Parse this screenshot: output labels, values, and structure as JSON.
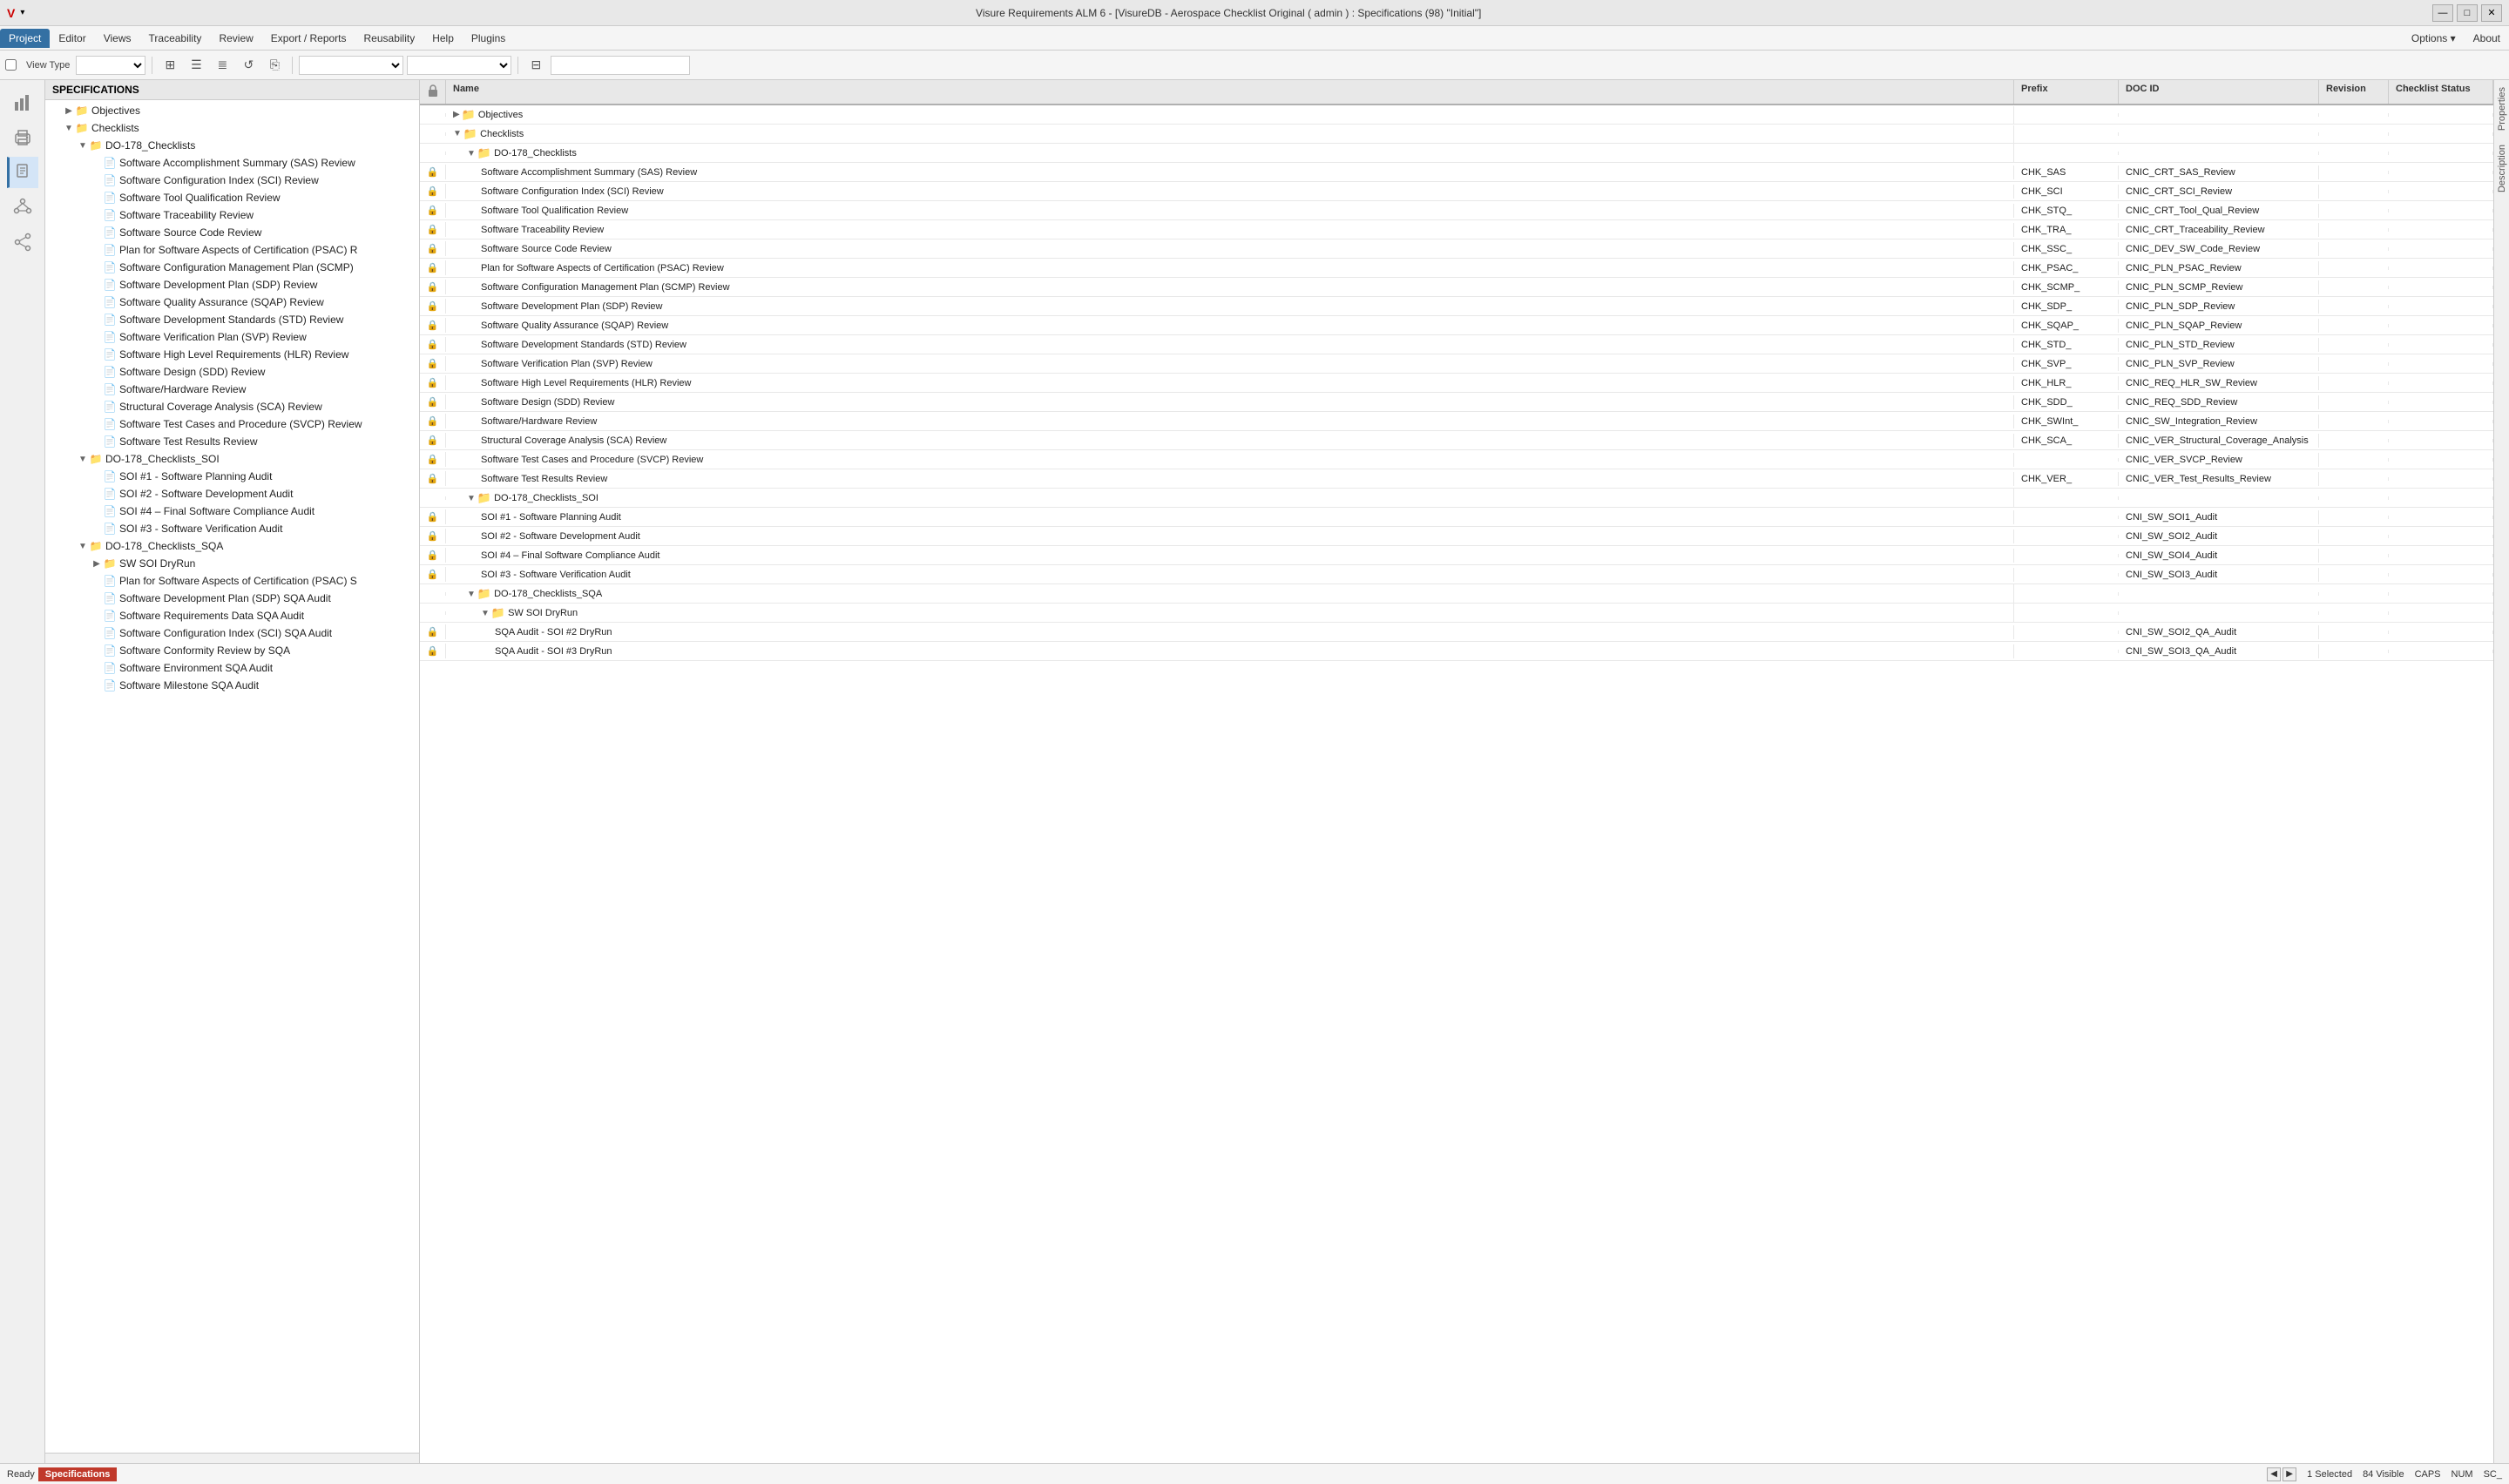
{
  "titlebar": {
    "title": "Visure Requirements ALM 6 - [VisureDB - Aerospace Checklist Original ( admin ) : Specifications (98) \"Initial\"]",
    "minimize": "—",
    "maximize": "□",
    "close": "✕",
    "logo": "V"
  },
  "menubar": {
    "items": [
      {
        "label": "Project",
        "active": true
      },
      {
        "label": "Editor"
      },
      {
        "label": "Views"
      },
      {
        "label": "Traceability"
      },
      {
        "label": "Review"
      },
      {
        "label": "Export / Reports"
      },
      {
        "label": "Reusability"
      },
      {
        "label": "Help"
      },
      {
        "label": "Plugins"
      },
      {
        "label": "Options ▾",
        "right": true
      },
      {
        "label": "About",
        "right": true
      }
    ]
  },
  "toolbar": {
    "view_type_label": "View Type",
    "filter_icon": "⊞",
    "icons": [
      "⊞",
      "☰",
      "≣",
      "↺",
      "⎘"
    ],
    "search_placeholder": ""
  },
  "iconbar": {
    "icons": [
      {
        "name": "chart",
        "symbol": "📊"
      },
      {
        "name": "print",
        "symbol": "🖨"
      },
      {
        "name": "doc",
        "symbol": "📄"
      },
      {
        "name": "network",
        "symbol": "⬡"
      },
      {
        "name": "share",
        "symbol": "⬡"
      }
    ]
  },
  "tree": {
    "header": "SPECIFICATIONS",
    "nodes": [
      {
        "id": "objectives",
        "label": "Objectives",
        "level": 0,
        "type": "folder",
        "expandable": true,
        "expanded": false
      },
      {
        "id": "checklists",
        "label": "Checklists",
        "level": 0,
        "type": "folder",
        "expandable": true,
        "expanded": true
      },
      {
        "id": "do178-checklists",
        "label": "DO-178_Checklists",
        "level": 1,
        "type": "folder",
        "expandable": true,
        "expanded": true
      },
      {
        "id": "item1",
        "label": "Software Accomplishment Summary (SAS) Review",
        "level": 2,
        "type": "doc"
      },
      {
        "id": "item2",
        "label": "Software Configuration Index (SCI) Review",
        "level": 2,
        "type": "doc"
      },
      {
        "id": "item3",
        "label": "Software Tool Qualification Review",
        "level": 2,
        "type": "doc"
      },
      {
        "id": "item4",
        "label": "Software Traceability Review",
        "level": 2,
        "type": "doc"
      },
      {
        "id": "item5",
        "label": "Software Source Code Review",
        "level": 2,
        "type": "doc"
      },
      {
        "id": "item6",
        "label": "Plan for Software Aspects of Certification (PSAC) R",
        "level": 2,
        "type": "doc"
      },
      {
        "id": "item7",
        "label": "Software Configuration Management Plan (SCMP)",
        "level": 2,
        "type": "doc"
      },
      {
        "id": "item8",
        "label": "Software Development Plan (SDP) Review",
        "level": 2,
        "type": "doc"
      },
      {
        "id": "item9",
        "label": "Software Quality Assurance (SQAP) Review",
        "level": 2,
        "type": "doc"
      },
      {
        "id": "item10",
        "label": "Software Development Standards (STD) Review",
        "level": 2,
        "type": "doc"
      },
      {
        "id": "item11",
        "label": "Software Verification Plan (SVP) Review",
        "level": 2,
        "type": "doc"
      },
      {
        "id": "item12",
        "label": "Software High Level Requirements (HLR) Review",
        "level": 2,
        "type": "doc"
      },
      {
        "id": "item13",
        "label": "Software Design (SDD) Review",
        "level": 2,
        "type": "doc"
      },
      {
        "id": "item14",
        "label": "Software/Hardware Review",
        "level": 2,
        "type": "doc"
      },
      {
        "id": "item15",
        "label": "Structural Coverage Analysis (SCA) Review",
        "level": 2,
        "type": "doc"
      },
      {
        "id": "item16",
        "label": "Software Test Cases and Procedure (SVCP) Review",
        "level": 2,
        "type": "doc"
      },
      {
        "id": "item17",
        "label": "Software Test Results Review",
        "level": 2,
        "type": "doc"
      },
      {
        "id": "do178-checklists-soi",
        "label": "DO-178_Checklists_SOI",
        "level": 1,
        "type": "folder",
        "expandable": true,
        "expanded": true
      },
      {
        "id": "soi1",
        "label": "SOI #1 - Software Planning Audit",
        "level": 2,
        "type": "doc"
      },
      {
        "id": "soi2",
        "label": "SOI #2 - Software Development Audit",
        "level": 2,
        "type": "doc"
      },
      {
        "id": "soi4",
        "label": "SOI #4 – Final Software Compliance Audit",
        "level": 2,
        "type": "doc"
      },
      {
        "id": "soi3",
        "label": "SOI #3 - Software Verification Audit",
        "level": 2,
        "type": "doc"
      },
      {
        "id": "do178-checklists-sqa",
        "label": "DO-178_Checklists_SQA",
        "level": 1,
        "type": "folder",
        "expandable": true,
        "expanded": true
      },
      {
        "id": "sw-soi-dryrun",
        "label": "SW SOI DryRun",
        "level": 2,
        "type": "folder",
        "expandable": true,
        "expanded": false
      },
      {
        "id": "psac-s",
        "label": "Plan for Software Aspects of Certification (PSAC) S",
        "level": 2,
        "type": "doc"
      },
      {
        "id": "sdp-sqa",
        "label": "Software Development Plan (SDP) SQA Audit",
        "level": 2,
        "type": "doc"
      },
      {
        "id": "srd-sqa",
        "label": "Software Requirements Data SQA Audit",
        "level": 2,
        "type": "doc"
      },
      {
        "id": "sci-sqa",
        "label": "Software Configuration Index (SCI) SQA Audit",
        "level": 2,
        "type": "doc"
      },
      {
        "id": "scr-sqa",
        "label": "Software Conformity Review by SQA",
        "level": 2,
        "type": "doc"
      },
      {
        "id": "sea-sqa",
        "label": "Software Environment SQA Audit",
        "level": 2,
        "type": "doc"
      },
      {
        "id": "sm-sqa",
        "label": "Software Milestone SQA Audit",
        "level": 2,
        "type": "doc"
      }
    ]
  },
  "grid": {
    "columns": [
      {
        "key": "lock",
        "label": "🔒"
      },
      {
        "key": "name",
        "label": "Name"
      },
      {
        "key": "prefix",
        "label": "Prefix"
      },
      {
        "key": "docid",
        "label": "DOC ID"
      },
      {
        "key": "revision",
        "label": "Revision"
      },
      {
        "key": "status",
        "label": "Checklist Status"
      }
    ],
    "rows": [
      {
        "indent": 0,
        "type": "folder",
        "expand": "▶",
        "name": "Objectives",
        "prefix": "",
        "docid": "",
        "revision": "",
        "status": "",
        "locked": true
      },
      {
        "indent": 0,
        "type": "folder",
        "expand": "▼",
        "name": "Checklists",
        "prefix": "",
        "docid": "",
        "revision": "",
        "status": "",
        "locked": false
      },
      {
        "indent": 1,
        "type": "folder",
        "expand": "▼",
        "name": "DO-178_Checklists",
        "prefix": "",
        "docid": "",
        "revision": "",
        "status": "",
        "locked": false
      },
      {
        "indent": 2,
        "type": "doc",
        "expand": "",
        "name": "Software Accomplishment Summary (SAS) Review",
        "prefix": "CHK_SAS",
        "docid": "CNIC_CRT_SAS_Review",
        "revision": "",
        "status": "",
        "locked": true
      },
      {
        "indent": 2,
        "type": "doc",
        "expand": "",
        "name": "Software Configuration Index (SCI) Review",
        "prefix": "CHK_SCI",
        "docid": "CNIC_CRT_SCI_Review",
        "revision": "",
        "status": "",
        "locked": true
      },
      {
        "indent": 2,
        "type": "doc",
        "expand": "",
        "name": "Software Tool Qualification Review",
        "prefix": "CHK_STQ_",
        "docid": "CNIC_CRT_Tool_Qual_Review",
        "revision": "",
        "status": "",
        "locked": true
      },
      {
        "indent": 2,
        "type": "doc",
        "expand": "",
        "name": "Software Traceability Review",
        "prefix": "CHK_TRA_",
        "docid": "CNIC_CRT_Traceability_Review",
        "revision": "",
        "status": "",
        "locked": true
      },
      {
        "indent": 2,
        "type": "doc",
        "expand": "",
        "name": "Software Source Code Review",
        "prefix": "CHK_SSC_",
        "docid": "CNIC_DEV_SW_Code_Review",
        "revision": "",
        "status": "",
        "locked": true
      },
      {
        "indent": 2,
        "type": "doc",
        "expand": "",
        "name": "Plan for Software Aspects of Certification (PSAC) Review",
        "prefix": "CHK_PSAC_",
        "docid": "CNIC_PLN_PSAC_Review",
        "revision": "",
        "status": "",
        "locked": true
      },
      {
        "indent": 2,
        "type": "doc",
        "expand": "",
        "name": "Software Configuration Management Plan (SCMP) Review",
        "prefix": "CHK_SCMP_",
        "docid": "CNIC_PLN_SCMP_Review",
        "revision": "",
        "status": "",
        "locked": true
      },
      {
        "indent": 2,
        "type": "doc",
        "expand": "",
        "name": "Software Development Plan (SDP) Review",
        "prefix": "CHK_SDP_",
        "docid": "CNIC_PLN_SDP_Review",
        "revision": "",
        "status": "",
        "locked": true
      },
      {
        "indent": 2,
        "type": "doc",
        "expand": "",
        "name": "Software Quality Assurance (SQAP) Review",
        "prefix": "CHK_SQAP_",
        "docid": "CNIC_PLN_SQAP_Review",
        "revision": "",
        "status": "",
        "locked": true
      },
      {
        "indent": 2,
        "type": "doc",
        "expand": "",
        "name": "Software Development Standards (STD) Review",
        "prefix": "CHK_STD_",
        "docid": "CNIC_PLN_STD_Review",
        "revision": "",
        "status": "",
        "locked": true
      },
      {
        "indent": 2,
        "type": "doc",
        "expand": "",
        "name": "Software Verification Plan (SVP) Review",
        "prefix": "CHK_SVP_",
        "docid": "CNIC_PLN_SVP_Review",
        "revision": "",
        "status": "",
        "locked": true
      },
      {
        "indent": 2,
        "type": "doc",
        "expand": "",
        "name": "Software High Level Requirements (HLR) Review",
        "prefix": "CHK_HLR_",
        "docid": "CNIC_REQ_HLR_SW_Review",
        "revision": "",
        "status": "",
        "locked": true
      },
      {
        "indent": 2,
        "type": "doc",
        "expand": "",
        "name": "Software Design (SDD) Review",
        "prefix": "CHK_SDD_",
        "docid": "CNIC_REQ_SDD_Review",
        "revision": "",
        "status": "",
        "locked": true
      },
      {
        "indent": 2,
        "type": "doc",
        "expand": "",
        "name": "Software/Hardware Review",
        "prefix": "CHK_SWInt_",
        "docid": "CNIC_SW_Integration_Review",
        "revision": "",
        "status": "",
        "locked": true
      },
      {
        "indent": 2,
        "type": "doc",
        "expand": "",
        "name": "Structural Coverage Analysis (SCA) Review",
        "prefix": "CHK_SCA_",
        "docid": "CNIC_VER_Structural_Coverage_Analysis",
        "revision": "",
        "status": "",
        "locked": true
      },
      {
        "indent": 2,
        "type": "doc",
        "expand": "",
        "name": "Software Test Cases and Procedure (SVCP) Review",
        "prefix": "",
        "docid": "CNIC_VER_SVCP_Review",
        "revision": "",
        "status": "",
        "locked": true
      },
      {
        "indent": 2,
        "type": "doc",
        "expand": "",
        "name": "Software Test Results Review",
        "prefix": "CHK_VER_",
        "docid": "CNIC_VER_Test_Results_Review",
        "revision": "",
        "status": "",
        "locked": true
      },
      {
        "indent": 1,
        "type": "folder",
        "expand": "▼",
        "name": "DO-178_Checklists_SOI",
        "prefix": "",
        "docid": "",
        "revision": "",
        "status": "",
        "locked": false
      },
      {
        "indent": 2,
        "type": "doc",
        "expand": "",
        "name": "SOI #1 - Software Planning Audit",
        "prefix": "",
        "docid": "CNI_SW_SOI1_Audit",
        "revision": "",
        "status": "",
        "locked": true
      },
      {
        "indent": 2,
        "type": "doc",
        "expand": "",
        "name": "SOI #2 - Software Development Audit",
        "prefix": "",
        "docid": "CNI_SW_SOI2_Audit",
        "revision": "",
        "status": "",
        "locked": true
      },
      {
        "indent": 2,
        "type": "doc",
        "expand": "",
        "name": "SOI #4 – Final Software Compliance Audit",
        "prefix": "",
        "docid": "CNI_SW_SOI4_Audit",
        "revision": "",
        "status": "",
        "locked": true
      },
      {
        "indent": 2,
        "type": "doc",
        "expand": "",
        "name": "SOI #3 - Software Verification Audit",
        "prefix": "",
        "docid": "CNI_SW_SOI3_Audit",
        "revision": "",
        "status": "",
        "locked": true
      },
      {
        "indent": 1,
        "type": "folder",
        "expand": "▼",
        "name": "DO-178_Checklists_SQA",
        "prefix": "",
        "docid": "",
        "revision": "",
        "status": "",
        "locked": false
      },
      {
        "indent": 2,
        "type": "folder",
        "expand": "▼",
        "name": "SW SOI DryRun",
        "prefix": "",
        "docid": "",
        "revision": "",
        "status": "",
        "locked": false
      },
      {
        "indent": 3,
        "type": "doc",
        "expand": "",
        "name": "SQA Audit - SOI #2 DryRun",
        "prefix": "",
        "docid": "CNI_SW_SOI2_QA_Audit",
        "revision": "",
        "status": "",
        "locked": true
      },
      {
        "indent": 3,
        "type": "doc",
        "expand": "",
        "name": "SQA Audit - SOI #3 DryRun",
        "prefix": "",
        "docid": "CNI_SW_SOI3_QA_Audit",
        "revision": "",
        "status": "",
        "locked": true
      }
    ]
  },
  "statusbar": {
    "ready": "Ready",
    "badge": "Specifications",
    "selected": "1 Selected",
    "visible": "84 Visible",
    "caps": "CAPS",
    "num": "NUM",
    "sc": "SC_"
  }
}
